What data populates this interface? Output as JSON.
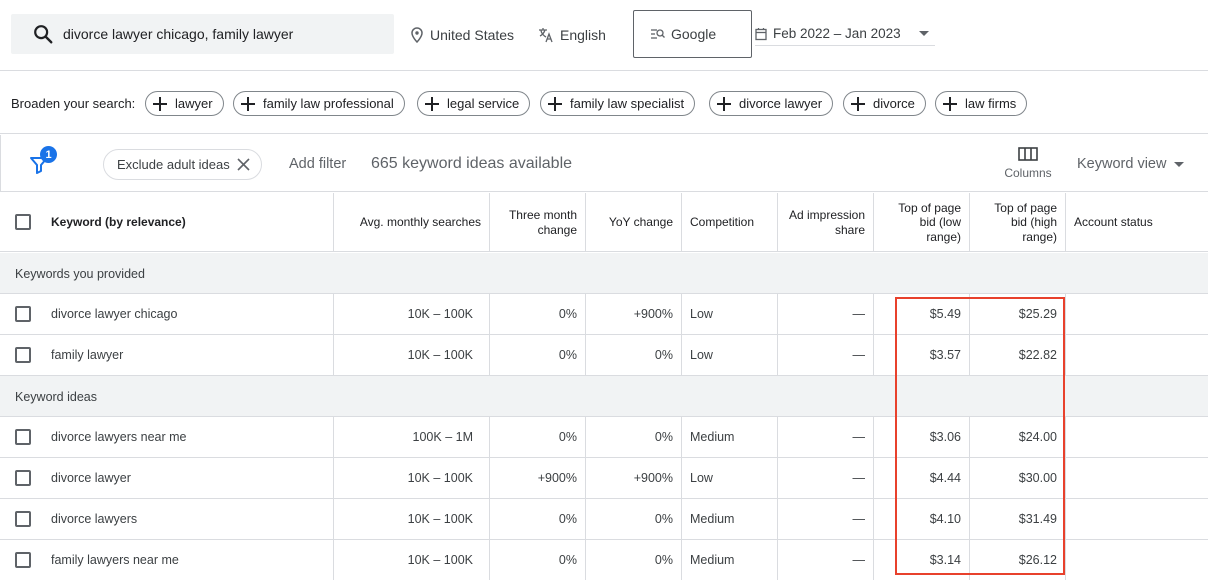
{
  "search": {
    "query": "divorce lawyer chicago, family lawyer",
    "location": "United States",
    "language": "English",
    "network": "Google",
    "date_range": "Feb 2022 – Jan 2023"
  },
  "broaden": {
    "label": "Broaden your search:",
    "chips": [
      "lawyer",
      "family law professional",
      "legal service",
      "family law specialist",
      "divorce lawyer",
      "divorce",
      "law firms"
    ]
  },
  "filterbar": {
    "badge": "1",
    "exclude_chip": "Exclude adult ideas",
    "add_filter": "Add filter",
    "count": "665 keyword ideas available",
    "columns_label": "Columns",
    "view_label": "Keyword view"
  },
  "table": {
    "headers": {
      "keyword": "Keyword (by relevance)",
      "avg": "Avg. monthly searches",
      "three_month_1": "Three month",
      "three_month_2": "change",
      "yoy": "YoY change",
      "competition": "Competition",
      "ad_imp_1": "Ad impression",
      "ad_imp_2": "share",
      "low_1": "Top of page",
      "low_2": "bid (low",
      "low_3": "range)",
      "high_1": "Top of page",
      "high_2": "bid (high",
      "high_3": "range)",
      "account": "Account status"
    },
    "section_provided": "Keywords you provided",
    "section_ideas": "Keyword ideas",
    "provided": [
      {
        "keyword": "divorce lawyer chicago",
        "avg": "10K – 100K",
        "three": "0%",
        "yoy": "+900%",
        "comp": "Low",
        "ad": "—",
        "low": "$5.49",
        "high": "$25.29"
      },
      {
        "keyword": "family lawyer",
        "avg": "10K – 100K",
        "three": "0%",
        "yoy": "0%",
        "comp": "Low",
        "ad": "—",
        "low": "$3.57",
        "high": "$22.82"
      }
    ],
    "ideas": [
      {
        "keyword": "divorce lawyers near me",
        "avg": "100K – 1M",
        "three": "0%",
        "yoy": "0%",
        "comp": "Medium",
        "ad": "—",
        "low": "$3.06",
        "high": "$24.00"
      },
      {
        "keyword": "divorce lawyer",
        "avg": "10K – 100K",
        "three": "+900%",
        "yoy": "+900%",
        "comp": "Low",
        "ad": "—",
        "low": "$4.44",
        "high": "$30.00"
      },
      {
        "keyword": "divorce lawyers",
        "avg": "10K – 100K",
        "three": "0%",
        "yoy": "0%",
        "comp": "Medium",
        "ad": "—",
        "low": "$4.10",
        "high": "$31.49"
      },
      {
        "keyword": "family lawyers near me",
        "avg": "10K – 100K",
        "three": "0%",
        "yoy": "0%",
        "comp": "Medium",
        "ad": "—",
        "low": "$3.14",
        "high": "$26.12"
      }
    ]
  },
  "colors": {
    "highlight": "#e8412c",
    "accent": "#1a73e8"
  }
}
